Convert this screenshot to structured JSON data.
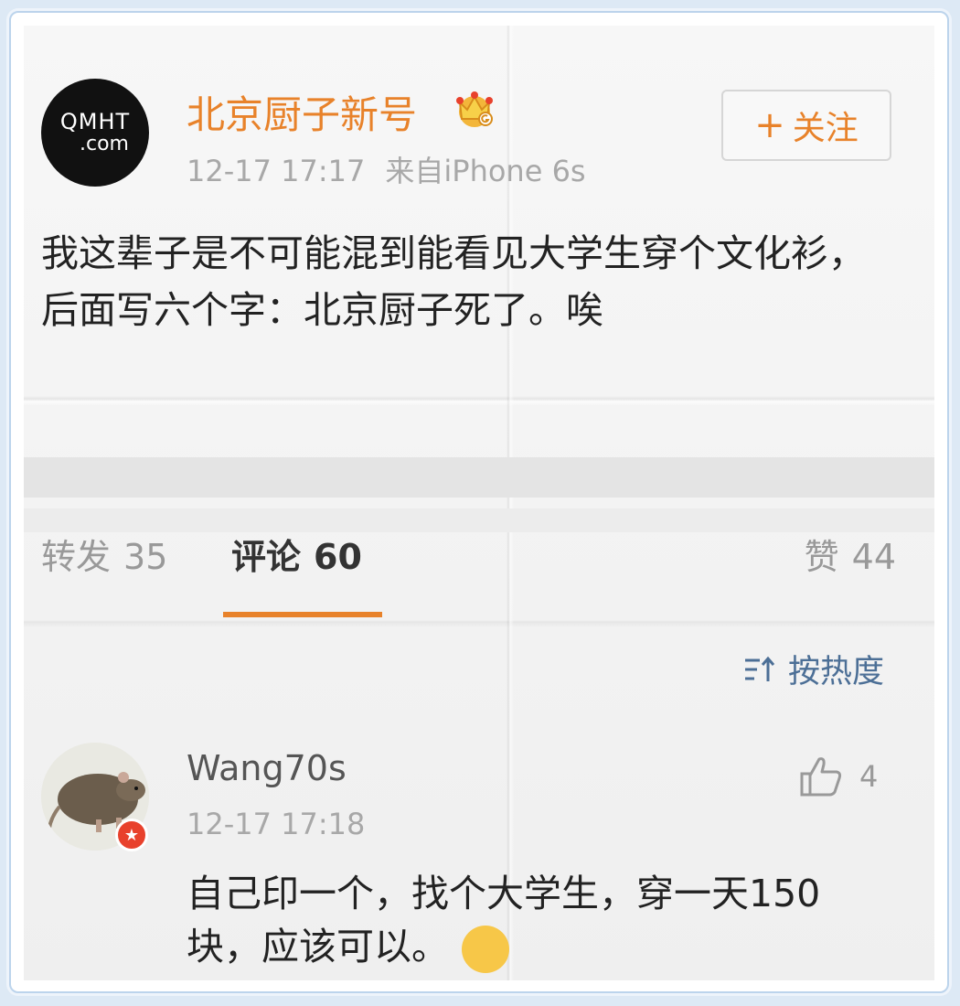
{
  "post": {
    "author": "北京厨子新号",
    "avatar_text_line1": "QMHT",
    "avatar_text_line2": ".com",
    "time": "12-17 17:17",
    "source": "来自iPhone 6s",
    "follow_label": "关注",
    "follow_plus": "+",
    "text": "我这辈子是不可能混到能看见大学生穿个文化衫，后面写六个字：北京厨子死了。唉"
  },
  "tabs": {
    "repost_label": "转发",
    "repost_count": "35",
    "comment_label": "评论",
    "comment_count": "60",
    "like_label": "赞",
    "like_count": "44"
  },
  "sort": {
    "label": "按热度"
  },
  "comment": {
    "user": "Wang70s",
    "time": "12-17 17:18",
    "like_count": "4",
    "text": "自己印一个，找个大学生，穿一天150块，应该可以。"
  },
  "icons": {
    "crown": "vip-crown-icon",
    "sort": "sort-icon",
    "thumb": "thumbs-up-icon",
    "badge": "verified-badge-icon",
    "emoji": "grin-emoji-icon"
  },
  "colors": {
    "accent": "#e8822a",
    "link": "#4c6f96",
    "badge": "#e8412c"
  }
}
